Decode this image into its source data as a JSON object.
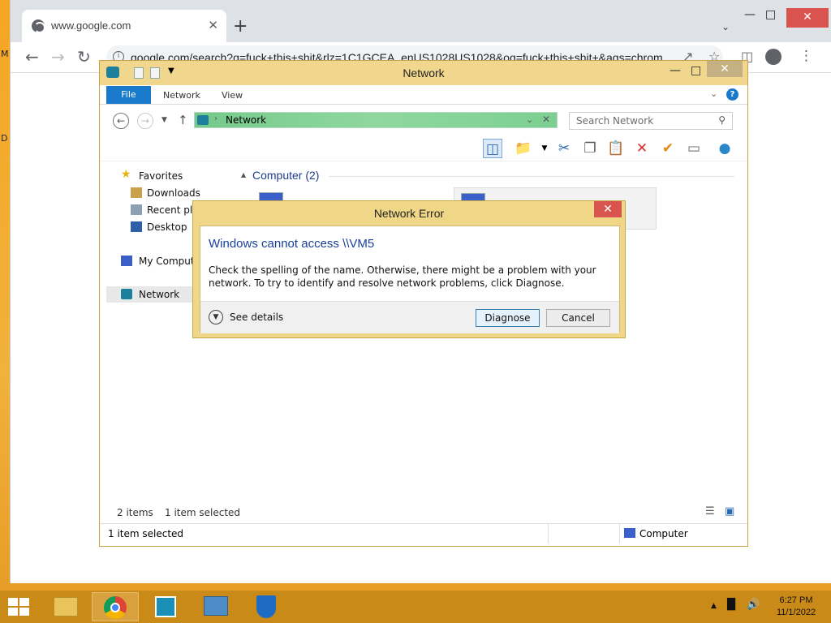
{
  "chrome": {
    "tab_title": "www.google.com",
    "url": "google.com/search?q=fuck+this+shit&rlz=1C1GCEA_enUS1028US1028&oq=fuck+this+shit+&aqs=chrom"
  },
  "desktop": {
    "label_m": "M",
    "label_d": "D"
  },
  "explorer": {
    "title": "Network",
    "ribbon_tabs": [
      "File",
      "Network",
      "View"
    ],
    "address": "Network",
    "search_placeholder": "Search Network",
    "nav": {
      "favorites": "Favorites",
      "downloads": "Downloads",
      "recent": "Recent pla",
      "desktop": "Desktop",
      "computer": "My Compute",
      "network": "Network"
    },
    "group_header": "Computer (2)",
    "status_items": "2 items",
    "status_selected": "1 item selected",
    "details_selected": "1 item selected",
    "details_computer": "Computer"
  },
  "dialog": {
    "title": "Network Error",
    "heading": "Windows cannot access \\\\VM5",
    "message": "Check the spelling of the name. Otherwise, there might be a problem with your network. To try to identify and resolve network problems, click Diagnose.",
    "see_details": "See details",
    "diagnose": "Diagnose",
    "cancel": "Cancel"
  },
  "taskbar": {
    "time": "6:27 PM",
    "date": "11/1/2022",
    "apps": [
      "file-explorer",
      "chrome",
      "photos",
      "control-panel",
      "windows-defender"
    ]
  },
  "colors": {
    "accent": "#1979ca",
    "title_bar": "#f0d78d",
    "close_red": "#d9534f",
    "address_green": "#7ccf91",
    "taskbar": "#c98a17"
  }
}
